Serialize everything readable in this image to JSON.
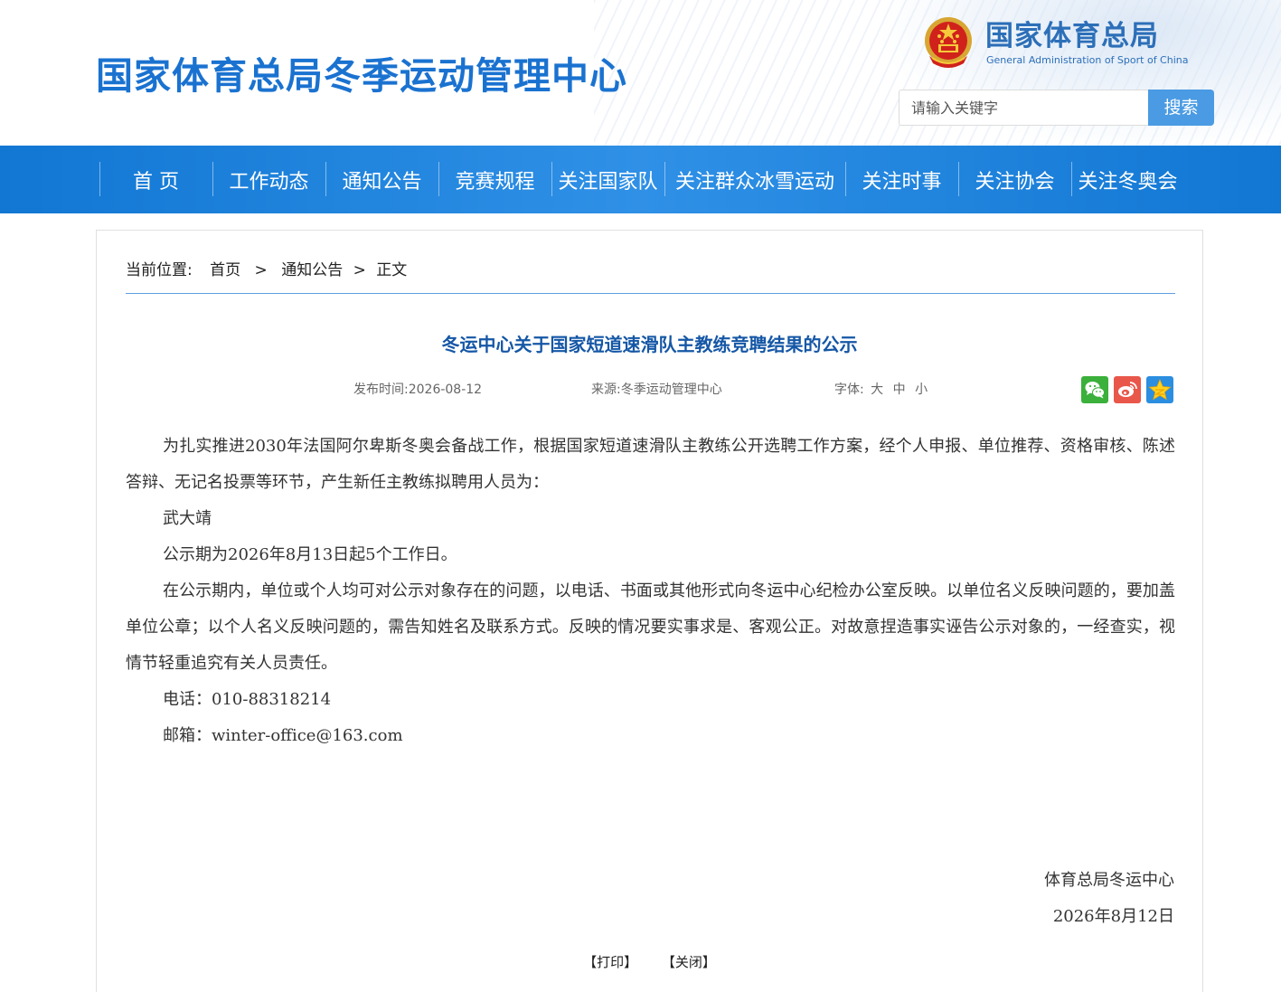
{
  "header": {
    "site_title": "国家体育总局冬季运动管理中心",
    "logo_cn": "国家体育总局",
    "logo_en": "General Administration of Sport of China",
    "search_placeholder": "请输入关键字",
    "search_button": "搜索"
  },
  "nav": {
    "items": [
      "首 页",
      "工作动态",
      "通知公告",
      "竞赛规程",
      "关注国家队",
      "关注群众冰雪运动",
      "关注时事",
      "关注协会",
      "关注冬奥会"
    ]
  },
  "breadcrumb": {
    "label": "当前位置:",
    "home": "首页",
    "sep1": ">",
    "section": "通知公告",
    "sep2": ">",
    "current": "正文"
  },
  "article": {
    "title": "冬运中心关于国家短道速滑队主教练竞聘结果的公示",
    "publish_time": "发布时间:2026-08-12",
    "source": "来源:冬季运动管理中心",
    "font_label": "字体:",
    "font_large": "大",
    "font_medium": "中",
    "font_small": "小",
    "paragraphs": [
      "为扎实推进2030年法国阿尔卑斯冬奥会备战工作，根据国家短道速滑队主教练公开选聘工作方案，经个人申报、单位推荐、资格审核、陈述答辩、无记名投票等环节，产生新任主教练拟聘用人员为：",
      "武大靖",
      "公示期为2026年8月13日起5个工作日。",
      "在公示期内，单位或个人均可对公示对象存在的问题，以电话、书面或其他形式向冬运中心纪检办公室反映。以单位名义反映问题的，要加盖单位公章；以个人名义反映问题的，需告知姓名及联系方式。反映的情况要实事求是、客观公正。对故意捏造事实诬告公示对象的，一经查实，视情节轻重追究有关人员责任。",
      "电话：010-88318214",
      "邮箱：winter-office@163.com"
    ],
    "sign_org": "体育总局冬运中心",
    "sign_date": "2026年8月12日"
  },
  "actions": {
    "print": "【打印】",
    "close": "【关闭】"
  },
  "share_icons": [
    "wechat-icon",
    "weibo-icon",
    "qzone-icon"
  ],
  "colors": {
    "title_blue": "#1a72d0",
    "nav_blue": "#1177d3",
    "article_title": "#1557a6",
    "search_button": "#4a9be3"
  }
}
